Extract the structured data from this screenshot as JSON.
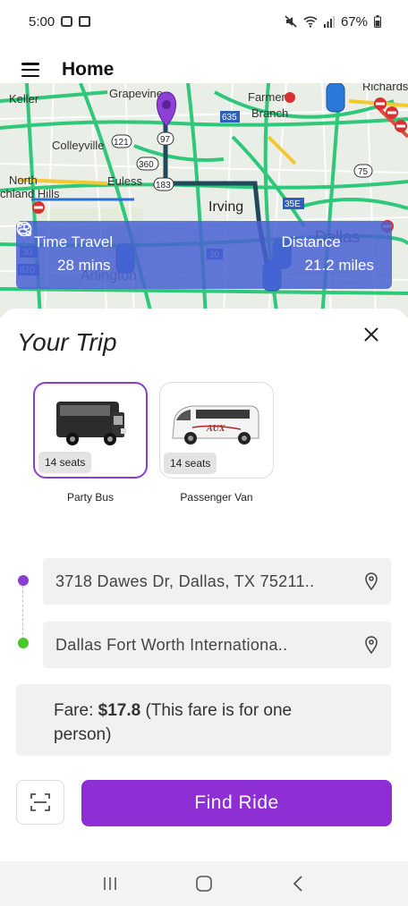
{
  "status_bar": {
    "time": "5:00",
    "battery": "67%"
  },
  "header": {
    "title": "Home"
  },
  "map": {
    "labels": [
      "Keller",
      "Grapevine",
      "Farmers",
      "Branch",
      "Richards",
      "Colleyville",
      "North",
      "chland Hills",
      "Euless",
      "Irving",
      "Arlington",
      "Dallas",
      "97",
      "121",
      "360",
      "183",
      "635",
      "75",
      "35E",
      "30",
      "820"
    ]
  },
  "info_card": {
    "time_label": "Time Travel",
    "time_value": "28 mins",
    "distance_label": "Distance",
    "distance_value": "21.2 miles"
  },
  "trip": {
    "title": "Your Trip",
    "vehicles": [
      {
        "name": "Party Bus",
        "seats": "14 seats",
        "selected": true
      },
      {
        "name": "Passenger Van",
        "seats": "14 seats",
        "selected": false
      }
    ],
    "pickup": "3718 Dawes Dr, Dallas, TX 75211..",
    "dropoff": "Dallas Fort Worth Internationa..",
    "fare_label": "Fare: ",
    "fare_amount": "$17.8",
    "fare_note": " (This fare is for one person)",
    "find_button": "Find Ride"
  },
  "colors": {
    "accent": "#8e2fd6",
    "info_card": "#4860d2",
    "pickup_dot": "#8a3fd1",
    "dropoff_dot": "#4cc72a"
  }
}
